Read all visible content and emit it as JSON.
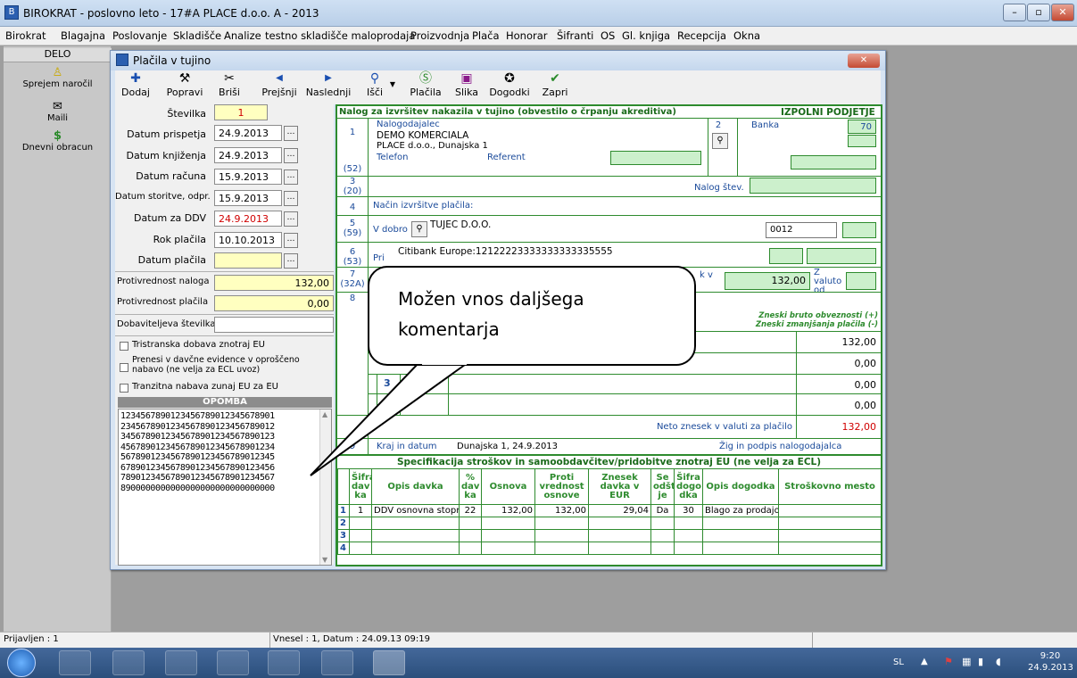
{
  "app": {
    "title": "BIROKRAT - poslovno leto - 17#A PLACE d.o.o. A - 2013",
    "menu": [
      "Birokrat",
      "Blagajna",
      "Poslovanje",
      "Skladišče",
      "Analize",
      "testno skladišče maloprodaja",
      "Proizvodnja",
      "Plača",
      "Honorar",
      "Šifranti",
      "OS",
      "Gl. knjiga",
      "Recepcija",
      "Okna"
    ]
  },
  "sidebar": {
    "header": "DELO",
    "items": [
      {
        "label": "Sprejem naročil",
        "icon": "person-icon"
      },
      {
        "label": "Maili",
        "icon": "mail-icon"
      },
      {
        "label": "Dnevni obracun",
        "icon": "dollar-icon"
      }
    ]
  },
  "window": {
    "title": "Plačila v tujino",
    "toolbar": [
      "Dodaj",
      "Popravi",
      "Briši",
      "Prejšnji",
      "Naslednji",
      "Išči",
      "Plačila",
      "Slika",
      "Dogodki",
      "Zapri"
    ]
  },
  "left": {
    "stevilka_label": "Številka",
    "stevilka": "1",
    "datum_prispetja_label": "Datum prispetja",
    "datum_prispetja": "24.9.2013",
    "datum_knjizenja_label": "Datum knjiženja",
    "datum_knjizenja": "24.9.2013",
    "datum_racuna_label": "Datum računa",
    "datum_racuna": "15.9.2013",
    "datum_storitve_label": "Datum storitve, odpr.",
    "datum_storitve": "15.9.2013",
    "datum_ddv_label": "Datum za DDV",
    "datum_ddv": "24.9.2013",
    "rok_placila_label": "Rok plačila",
    "rok_placila": "10.10.2013",
    "datum_placila_label": "Datum plačila",
    "datum_placila": "",
    "protivrednost_naloga_label": "Protivrednost naloga",
    "protivrednost_naloga": "132,00",
    "protivrednost_placila_label": "Protivrednost plačila",
    "protivrednost_placila": "0,00",
    "dobavitelj_label": "Dobaviteljeva številka",
    "dobavitelj": "",
    "cb1": "Tristranska dobava znotraj EU",
    "cb2a": "Prenesi v davčne evidence v oproščeno",
    "cb2b": "nabavo (ne velja za ECL uvoz)",
    "cb3": "Tranzitna nabava zunaj EU za EU",
    "opomba_label": "OPOMBA",
    "opomba_lines": [
      "1234567890123456789012345678901",
      "2345678901234567890123456789012",
      "3456789012345678901234567890123",
      "4567890123456789012345678901234",
      "5678901234567890123456789012345",
      "6789012345678901234567890123456",
      "7890123456789012345678901234567",
      "8900000000000000000000000000000"
    ]
  },
  "form": {
    "header": "Nalog za izvršitev nakazila v tujino (obvestilo o črpanju akreditiva)",
    "header_right": "IZPOLNI PODJETJE",
    "r1_num": "1",
    "r1_code": "(52)",
    "nalogodajalec_label": "Nalogodajalec",
    "nalogodajalec": "DEMO KOMERCIALA",
    "nalogodajalec_addr": "PLACE d.o.o., Dunajska 1",
    "telefon_label": "Telefon",
    "referent_label": "Referent",
    "r2_num": "2",
    "banka_label": "Banka",
    "banka_val": "70",
    "r3_num": "3",
    "r3_code": "(20)",
    "nalog_stev_label": "Nalog štev.",
    "r4_num": "4",
    "nacin_label": "Način izvršitve plačila:",
    "r5_num": "5",
    "r5_code": "(59)",
    "vdobro_label": "V dobro",
    "vdobro": "TUJEC D.O.O.",
    "vdobro_code": "0012",
    "r6_num": "6",
    "r6_code": "(53)",
    "pri_label": "Pri",
    "pri": "Citibank Europe:12122223333333333335555",
    "r7_num": "7",
    "r7_code": "(32A)",
    "znesek_label": "k v",
    "znesek": "132,00",
    "zvaluto_label": "Z valuto od",
    "r8_num": "8",
    "bruto_label": "Zneski bruto obveznosti (+)",
    "zmanj_label": "Zneski zmanjšanja plačila (-)",
    "amounts": [
      "132,00",
      "0,00",
      "0,00",
      "0,00"
    ],
    "r3b_num": "3",
    "neto_label": "Neto znesek v valuti za plačilo",
    "neto": "132,00",
    "r9_num": "9",
    "kraj_label": "Kraj in datum",
    "kraj": "Dunajska 1, 24.9.2013",
    "zig_label": "Žig in podpis nalogodajalca"
  },
  "spec": {
    "title": "Specifikacija stroškov in samoobdavčitev/pridobitve znotraj EU (ne velja za ECL)",
    "headers": [
      "",
      "Šifra dav ka",
      "Opis davka",
      "% dav ka",
      "Osnova",
      "Proti vrednost osnove",
      "Znesek davka v EUR",
      "Se odšte je",
      "Šifra dogo dka",
      "Opis dogodka",
      "Stroškovno mesto"
    ],
    "rows": [
      [
        "1",
        "1",
        "DDV osnovna stopr",
        "22",
        "132,00",
        "132,00",
        "29,04",
        "Da",
        "30",
        "Blago za prodajo",
        ""
      ],
      [
        "2",
        "",
        "",
        "",
        "",
        "",
        "",
        "",
        "",
        "",
        ""
      ],
      [
        "3",
        "",
        "",
        "",
        "",
        "",
        "",
        "",
        "",
        "",
        ""
      ],
      [
        "4",
        "",
        "",
        "",
        "",
        "",
        "",
        "",
        "",
        "",
        ""
      ]
    ]
  },
  "callout": {
    "text_line1": "Možen vnos daljšega",
    "text_line2": "komentarja"
  },
  "status": {
    "prijavljen": "Prijavljen : 1",
    "vnesel": "Vnesel : 1, Datum : 24.09.13 09:19"
  },
  "tray": {
    "lang": "SL",
    "time": "9:20",
    "date": "24.9.2013"
  },
  "colors": {
    "accent_green": "#2e8b2e",
    "red": "#d00000",
    "yellow": "#ffffc0",
    "light_green": "#ccf0cc"
  }
}
